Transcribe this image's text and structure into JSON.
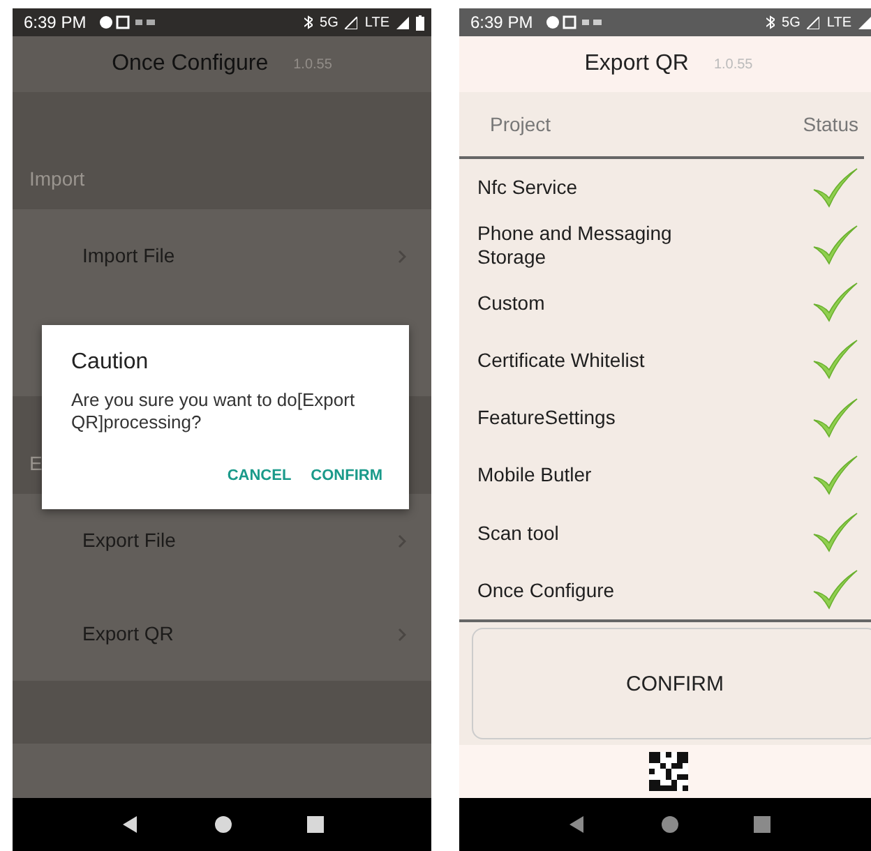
{
  "phones": [
    {
      "status_bar": {
        "time": "6:39 PM",
        "network": "5G",
        "network2": "LTE"
      },
      "header": {
        "title": "Once Configure",
        "version": "1.0.55"
      },
      "sections": [
        {
          "title": "Import",
          "items": [
            {
              "kind": "row",
              "label": "Import File"
            },
            {
              "kind": "row"
            }
          ]
        },
        {
          "title": "E",
          "items": [
            {
              "kind": "row",
              "label": "Export File"
            },
            {
              "kind": "row",
              "label": "Export QR"
            }
          ]
        }
      ],
      "dialog": {
        "title": "Caution",
        "message": "Are you sure you want to do[Export QR]processing?",
        "buttons": [
          "CANCEL",
          "CONFIRM"
        ]
      }
    },
    {
      "status_bar": {
        "time": "6:39 PM",
        "network": "5G",
        "network2": "LTE"
      },
      "header": {
        "title": "Export QR",
        "version": "1.0.55"
      },
      "table": {
        "columns": [
          "Project",
          "Status"
        ],
        "rows": [
          {
            "project": "Nfc Service",
            "done": true
          },
          {
            "project": "Phone and Messaging Storage",
            "done": true
          },
          {
            "project": "Custom",
            "done": true
          },
          {
            "project": "Certificate Whitelist",
            "done": true
          },
          {
            "project": "FeatureSettings",
            "done": true
          },
          {
            "project": "Mobile Butler",
            "done": true
          },
          {
            "project": "Scan tool",
            "done": true
          },
          {
            "project": "Once Configure",
            "done": true
          }
        ]
      },
      "confirm_button": "CONFIRM"
    }
  ]
}
